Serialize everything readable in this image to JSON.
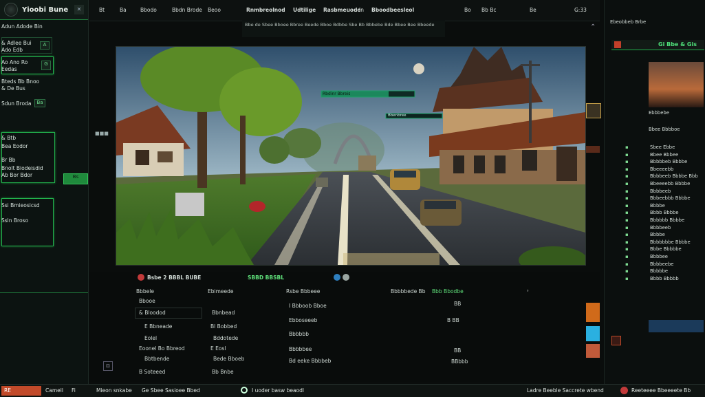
{
  "app": {
    "title": "Yioobi Bune"
  },
  "left": {
    "items": [
      "Adun Adode Bin",
      "& Adlee Bui",
      "Ado Edb",
      "Ao Ano Ro",
      "Eedas",
      "Bteds Bb Bnoo",
      "& De Bus",
      "Sdun Broda",
      "& Btb",
      "Bea Eodor",
      "Br Bb",
      "Bnolt Biodeisdid",
      "Ab Bor Bdor",
      "Ssi Bmieosicsd",
      "Ssln Broso"
    ],
    "chips": [
      "A",
      "G",
      "Ba"
    ],
    "action_label": "Bs"
  },
  "topbar": {
    "items": [
      "Bt",
      "Ba",
      "Bbodo",
      "Bbdn Brode",
      "Beoo",
      "Rnmbreolnod",
      "Udtilige",
      "Rasbmeuode",
      "In",
      "Bboodbeesleol"
    ],
    "right_items": [
      "Bo",
      "Bb Bc",
      "Be",
      "G:33"
    ],
    "description": "Bbe de Sbee Bboee Bbree Beede Bboe Bdbbe Sbe Bb Bbbebe Bde Bbee Bee Bbeede"
  },
  "game": {
    "hud_bar1": "Rbdinr Bbreis",
    "hud_bar2": "Bbenbree"
  },
  "panel": {
    "title": "Bsbe 2 BBBL BUBE",
    "tag": "SBBD BBSBL",
    "left_header": "Bbbele",
    "left_sub": "Bbooe",
    "left_rows": [
      "& Bloodod",
      "E Bbneade",
      "Eolel",
      "Eoonel Bo Bbreod",
      "Bbtbende",
      "B Soteeed"
    ],
    "mid_header": "Ebimeede",
    "mid_rows": [
      "Bbnbead",
      "Bl Bobbed",
      "Bddotede",
      "E Eosl",
      "Bede Bboeb",
      "Bb Bnbe"
    ],
    "col3_header": "Rsbe Bbbeee",
    "col3_rows": [
      "I Bbboob Bboe",
      "Ebboseeeb",
      "Bbbbbb",
      "Bbbbbee",
      "Bd eeke Bbbbeb"
    ],
    "col4_header": "Bbbbbede Bb",
    "col4_values": [
      "BB",
      "B BB",
      "BBbbb"
    ],
    "col5_header": "Bbb Bbodbe",
    "col5_values": [
      "BB"
    ]
  },
  "right": {
    "header": "Ebeobbeb Brbe",
    "title": "Gi Bbe & Gis",
    "thumb_caption_1": "Ebbbebe",
    "thumb_caption_2": "Bbee Bbbboe",
    "list": [
      "Sbee Ebbe",
      "Bbee Bbbee",
      "Bbbbbeb Bbbbe",
      "Bbeeeebb",
      "Bbbbeeb Bbbbe Bbb",
      "Bbeeeebb Bbbbe",
      "Bbbbeeb",
      "Bbbeebbb Bbbbe",
      "Bbbbe",
      "Bbbb Bbbbe",
      "Bbbbbb Bbbbe",
      "Bbbbeeb",
      "Bbbbe",
      "Bbbbbbbe Bbbbe",
      "Bbbe Bbbbbe",
      "Bbbbee",
      "Bbbbeebe",
      "Bbbbbe",
      "Bbbb Bbbbb"
    ]
  },
  "status": {
    "items": [
      "RE",
      "Camell",
      "Fi",
      "Mieon snkabe",
      "Ge Sbee Sasioee Bbed",
      "I uoder basw beaodl"
    ],
    "right": [
      "Ladre Beeble Saccrete wbend",
      "Reeteeee Bbeeeete Bb"
    ]
  },
  "colors": {
    "accent_green": "#22b14c",
    "panel_bg": "#0b0f0e",
    "hud_teal": "#1fa06a"
  }
}
